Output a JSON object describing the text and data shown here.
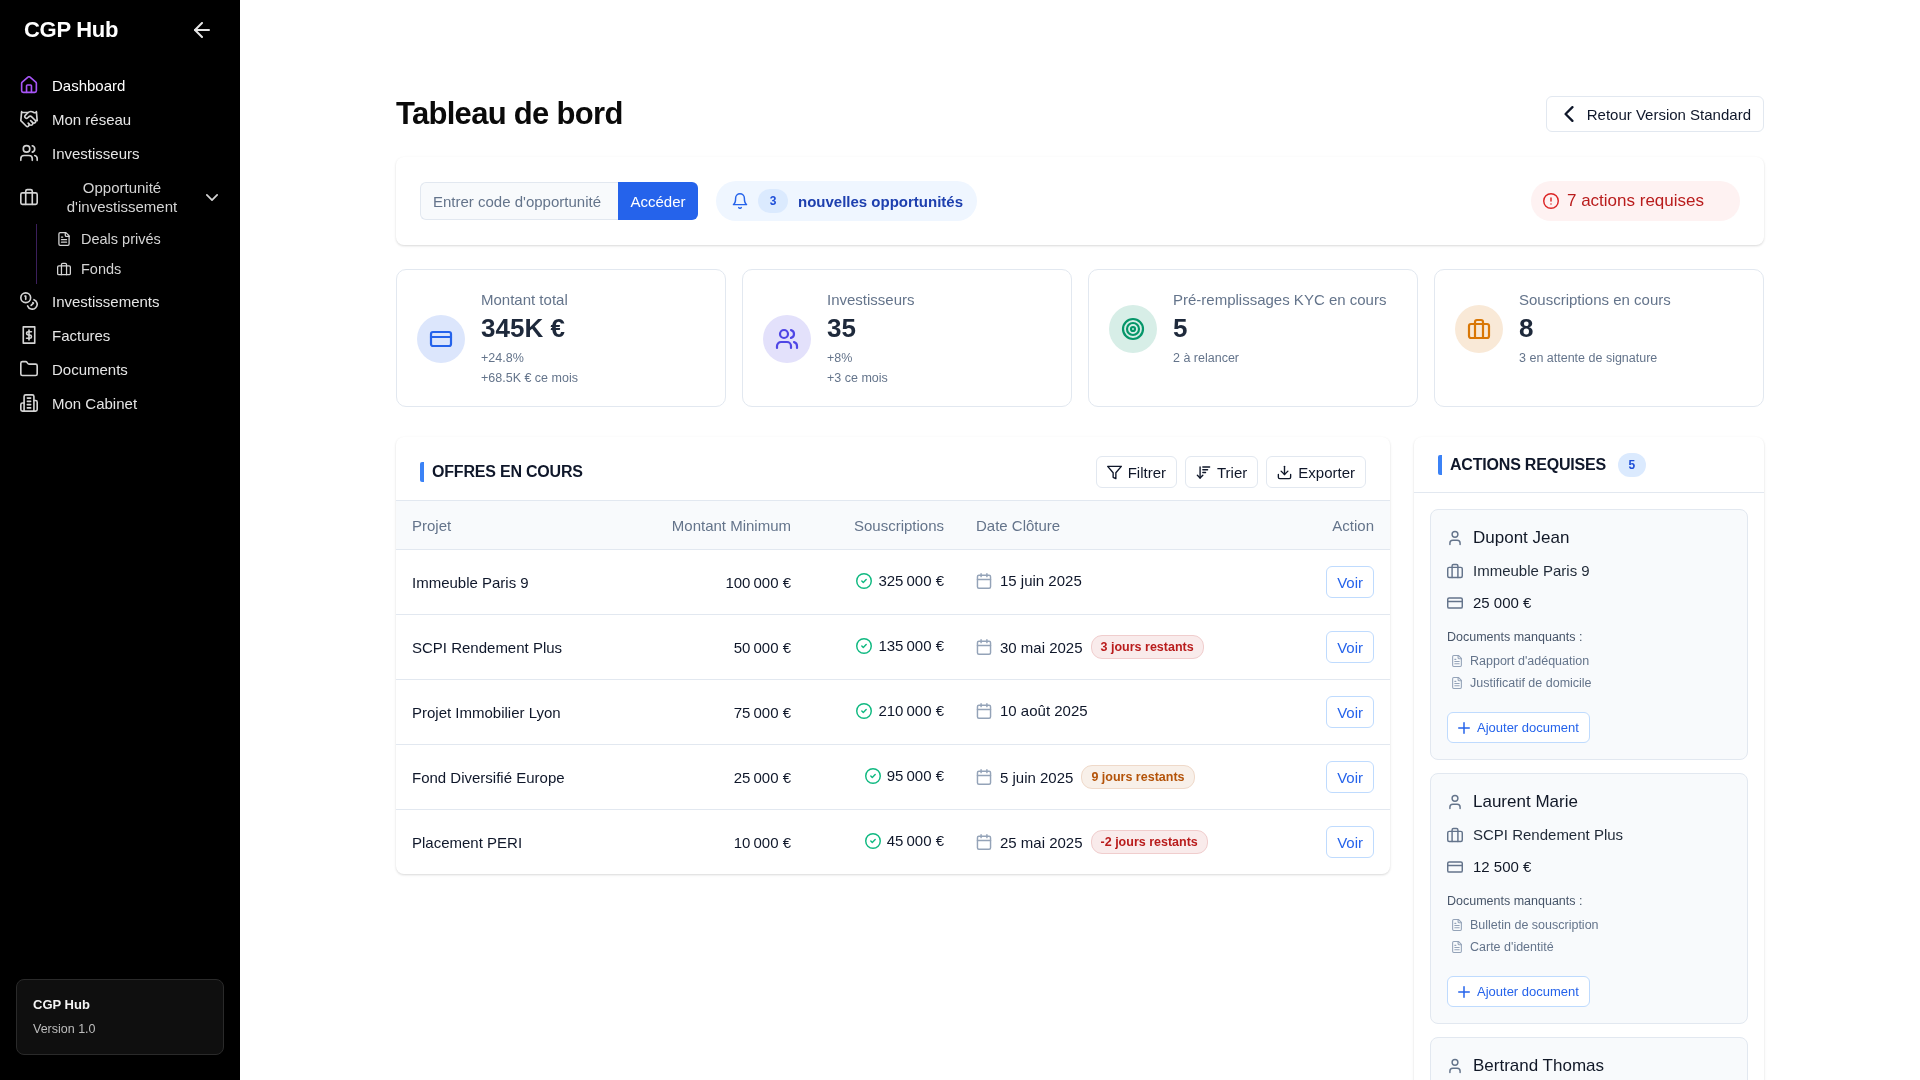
{
  "sidebar": {
    "logo": "CGP Hub",
    "nav": [
      {
        "label": "Dashboard",
        "selected": true
      },
      {
        "label": "Mon réseau",
        "selected": false
      },
      {
        "label": "Investisseurs",
        "selected": false
      },
      {
        "label": "Opportunité d'investissement",
        "selected": false,
        "expanded": true,
        "children": [
          {
            "label": "Deals privés",
            "selected": false
          },
          {
            "label": "Fonds",
            "selected": false
          }
        ]
      },
      {
        "label": "Investissements",
        "selected": false
      },
      {
        "label": "Factures",
        "selected": false
      },
      {
        "label": "Documents",
        "selected": false
      },
      {
        "label": "Mon Cabinet",
        "selected": false
      }
    ],
    "footer": {
      "name": "CGP Hub",
      "version": "Version 1.0"
    }
  },
  "header": {
    "title": "Tableau de bord",
    "back_button": "Retour Version Standard"
  },
  "opportunity_bar": {
    "search": {
      "placeholder": "Entrer code d'opportunité",
      "button": "Accéder"
    },
    "notification": {
      "count": "3",
      "text": "nouvelles opportunités"
    },
    "alert": "7 actions requises"
  },
  "stats": [
    {
      "label": "Montant total",
      "value": "345K €",
      "details": [
        "+24.8%",
        "+68.5K € ce mois"
      ],
      "color": "#2563eb"
    },
    {
      "label": "Investisseurs",
      "value": "35",
      "details": [
        "+8%",
        "+3 ce mois"
      ],
      "color": "#4f46e5"
    },
    {
      "label": "Pré-remplissages KYC en cours",
      "value": "5",
      "details": [
        "2 à relancer"
      ],
      "color": "#059669"
    },
    {
      "label": "Souscriptions en cours",
      "value": "8",
      "details": [
        "3 en attente de signature"
      ],
      "color": "#d97706"
    }
  ],
  "offers": {
    "title": "OFFRES EN COURS",
    "tools": [
      "Filtrer",
      "Trier",
      "Exporter"
    ],
    "columns": [
      "Projet",
      "Montant Minimum",
      "Souscriptions",
      "Date Clôture",
      "Action"
    ],
    "rows": [
      {
        "project": "Immeuble Paris 9",
        "minimum": "100 000 €",
        "subscriptions": "325 000 €",
        "closing_date": "15 juin 2025",
        "action": "Voir"
      },
      {
        "project": "SCPI Rendement Plus",
        "minimum": "50 000 €",
        "subscriptions": "135 000 €",
        "closing_date": "30 mai 2025",
        "deadline": {
          "text": "3 jours restants",
          "color": "#b91c1c"
        },
        "action": "Voir"
      },
      {
        "project": "Projet Immobilier Lyon",
        "minimum": "75 000 €",
        "subscriptions": "210 000 €",
        "closing_date": "10 août 2025",
        "action": "Voir"
      },
      {
        "project": "Fond Diversifié Europe",
        "minimum": "25 000 €",
        "subscriptions": "95 000 €",
        "closing_date": "5 juin 2025",
        "deadline": {
          "text": "9 jours restants",
          "color": "#b45309"
        },
        "action": "Voir"
      },
      {
        "project": "Placement PERI",
        "minimum": "10 000 €",
        "subscriptions": "45 000 €",
        "closing_date": "25 mai 2025",
        "deadline": {
          "text": "-2 jours restants",
          "color": "#b91c1c"
        },
        "action": "Voir"
      }
    ]
  },
  "actions": {
    "title": "ACTIONS REQUISES",
    "count": "5",
    "cards": [
      {
        "investor": "Dupont Jean",
        "project": "Immeuble Paris 9",
        "amount": "25 000 €",
        "docs_label": "Documents manquants :",
        "documents": [
          "Rapport d'adéquation",
          "Justificatif de domicile"
        ],
        "button": "Ajouter document"
      },
      {
        "investor": "Laurent Marie",
        "project": "SCPI Rendement Plus",
        "amount": "12 500 €",
        "docs_label": "Documents manquants :",
        "documents": [
          "Bulletin de souscription",
          "Carte d'identité"
        ],
        "button": "Ajouter document"
      },
      {
        "investor": "Bertrand Thomas"
      }
    ]
  }
}
